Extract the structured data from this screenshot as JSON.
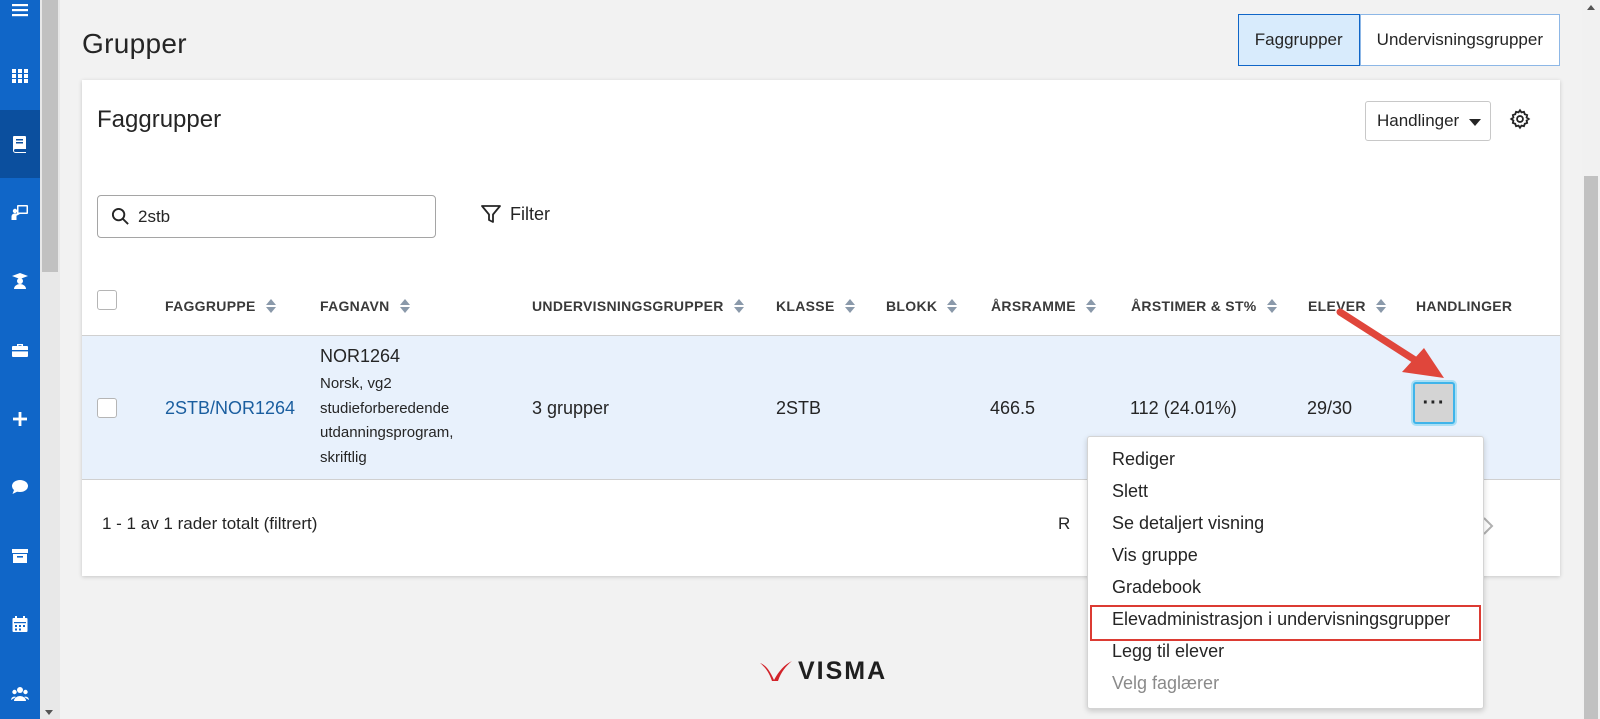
{
  "page": {
    "title": "Grupper",
    "tabs": [
      {
        "label": "Faggrupper",
        "active": true
      },
      {
        "label": "Undervisningsgrupper",
        "active": false
      }
    ]
  },
  "rail": {
    "items": [
      "menu-icon",
      "apps-grid-icon",
      "book-icon",
      "teacher-board-icon",
      "student-icon",
      "briefcase-icon",
      "plus-icon",
      "chat-icon",
      "archive-icon",
      "calendar-icon",
      "group-icon"
    ],
    "active": "book-icon"
  },
  "card": {
    "title": "Faggrupper",
    "actions_label": "Handlinger",
    "search_value": "2stb",
    "filter_label": "Filter"
  },
  "table": {
    "columns": [
      "FAGGRUPPE",
      "FAGNAVN",
      "UNDERVISNINGSGRUPPER",
      "KLASSE",
      "BLOKK",
      "ÅRSRAMME",
      "ÅRSTIMER & ST%",
      "ELEVER",
      "HANDLINGER"
    ],
    "rows": [
      {
        "faggruppe": "2STB/NOR1264",
        "fagnavn_code": "NOR1264",
        "fagnavn_desc": "Norsk, vg2 studieforberedende utdanningsprogram, skriftlig",
        "undervisningsgrupper": "3 grupper",
        "klasse": "2STB",
        "blokk": "",
        "arsramme": "466.5",
        "arstimer": "112 (24.01%)",
        "elever": "29/30",
        "actions_label": "···"
      }
    ],
    "footer_count": "1 - 1 av 1 rader totalt (filtrert)",
    "footer_partial": "R"
  },
  "menu": {
    "items": [
      "Rediger",
      "Slett",
      "Se detaljert visning",
      "Vis gruppe",
      "Gradebook",
      "Elevadministrasjon i undervisningsgrupper",
      "Legg til elever",
      "Velg faglærer"
    ],
    "highlighted": "Elevadministrasjon i undervisningsgrupper",
    "disabled": [
      "Velg faglærer"
    ]
  },
  "brand": {
    "logo_text": "VISMA",
    "primary": "#1066c8",
    "highlight": "#dc3b33"
  }
}
